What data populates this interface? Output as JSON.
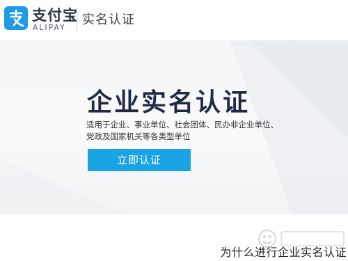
{
  "header": {
    "logo_cn": "支付宝",
    "logo_en": "ALIPAY",
    "section_title": "实名认证",
    "logo_icon": "alipay-logo-icon",
    "brand_color": "#1e9ae6"
  },
  "hero": {
    "title": "企业实名认证",
    "desc_line1": "适用于企业、事业单位、社会团体、民办非企业单位、",
    "desc_line2": "党政及国家机关等各类型单位",
    "button_label": "立即认证",
    "button_color": "#1aa3e5"
  },
  "bottom": {
    "heading": "为什么进行企业实名认证"
  },
  "watermark": {
    "icon": "baidu-jingyan-watermark"
  }
}
